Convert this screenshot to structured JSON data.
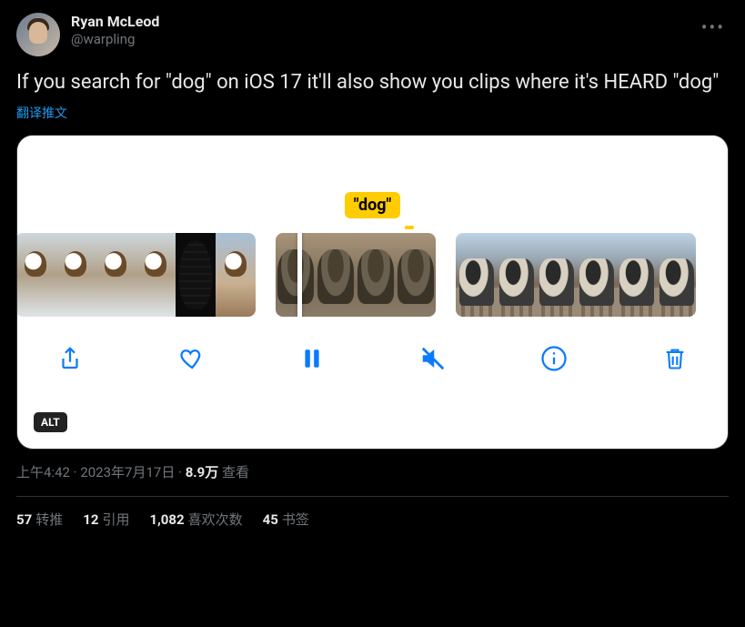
{
  "header": {
    "display_name": "Ryan McLeod",
    "handle": "@warpling",
    "more_label": "•••"
  },
  "tweet_text": "If you search for \"dog\" on iOS 17 it'll also show you clips where it's HEARD \"dog\"",
  "translate_label": "翻译推文",
  "media": {
    "search_term": "\"dog\"",
    "alt_badge": "ALT",
    "controls": {
      "share": "share",
      "like": "like",
      "pause": "pause",
      "mute": "mute",
      "info": "info",
      "trash": "trash"
    }
  },
  "meta": {
    "time": "上午4:42",
    "dot1": " · ",
    "date": "2023年7月17日",
    "dot2": " · ",
    "views_count": "8.9万",
    "views_label": " 查看"
  },
  "stats": {
    "retweets_count": "57",
    "retweets_label": "转推",
    "quotes_count": "12",
    "quotes_label": "引用",
    "likes_count": "1,082",
    "likes_label": "喜欢次数",
    "bookmarks_count": "45",
    "bookmarks_label": "书签"
  }
}
